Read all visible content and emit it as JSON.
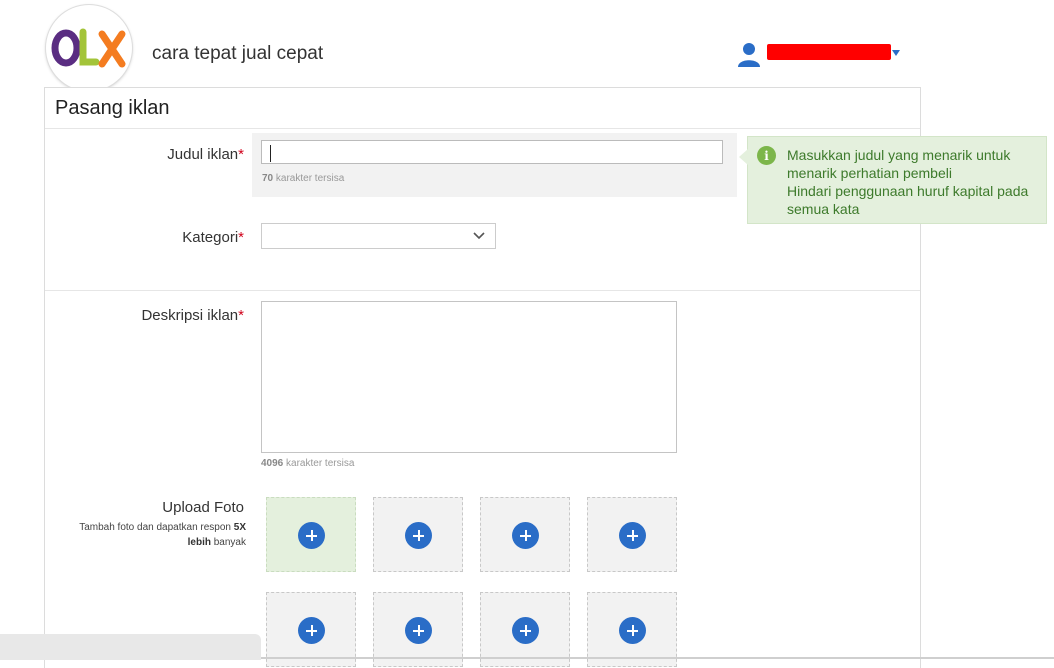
{
  "header": {
    "logo_text": "OLX",
    "tagline": "cara tepat jual cepat",
    "username_redacted": "",
    "user_icon": "user-icon"
  },
  "form": {
    "title": "Pasang iklan",
    "judul": {
      "label": "Judul iklan",
      "required_mark": "*",
      "value": "",
      "counter_number": "70",
      "counter_text": " karakter tersisa"
    },
    "kategori": {
      "label": "Kategori",
      "required_mark": "*",
      "selected": ""
    },
    "deskripsi": {
      "label": "Deskripsi iklan",
      "required_mark": "*",
      "value": "",
      "counter_number": "4096",
      "counter_text": " karakter tersisa"
    },
    "upload": {
      "label": "Upload Foto",
      "sub_pre": "Tambah foto dan dapatkan respon ",
      "sub_bold1": "5X",
      "sub_bold2": "lebih",
      "sub_post": " banyak",
      "slot_count": 8
    }
  },
  "tip": {
    "icon": "info-icon",
    "lines": [
      "Masukkan judul yang menarik untuk",
      "menarik perhatian pembeli",
      "Hindari penggunaan huruf kapital pada",
      "semua kata"
    ]
  },
  "colors": {
    "accent_blue": "#2a6dc7",
    "required_red": "#d0021b",
    "tip_bg": "#e4f0dd",
    "tip_text": "#3d7a2b"
  }
}
